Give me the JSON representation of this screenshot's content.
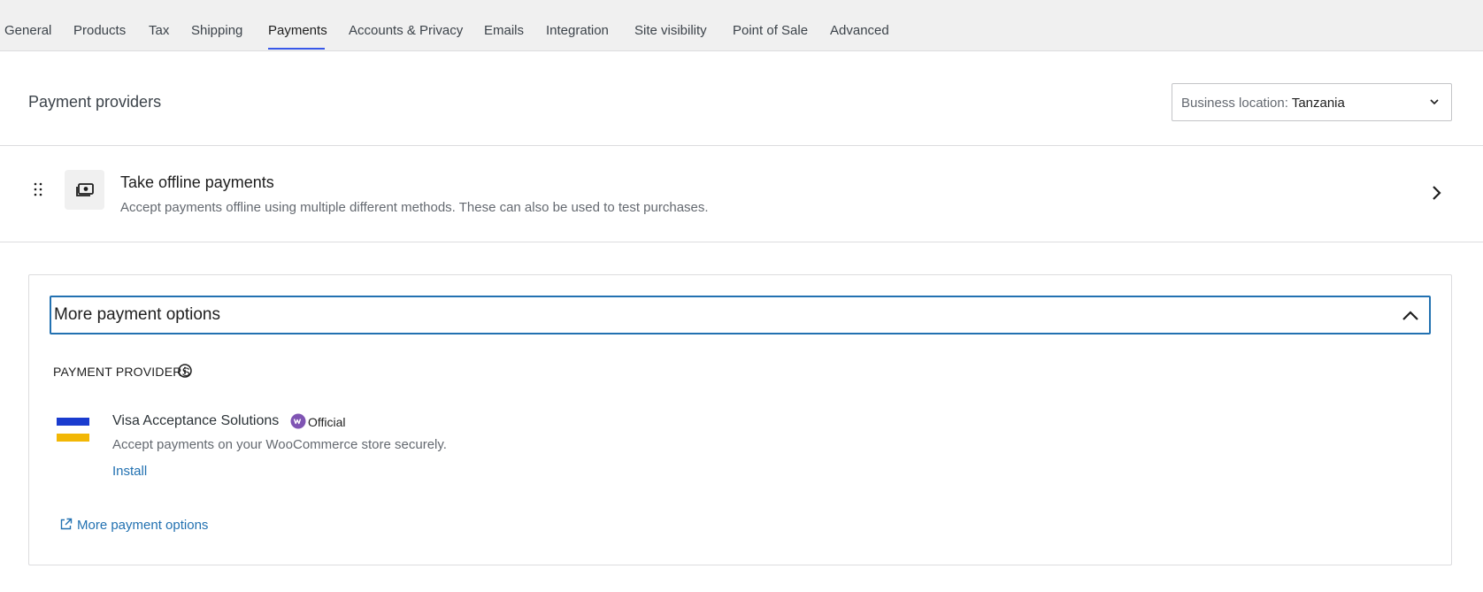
{
  "tabs": [
    {
      "label": "General"
    },
    {
      "label": "Products"
    },
    {
      "label": "Tax"
    },
    {
      "label": "Shipping"
    },
    {
      "label": "Payments"
    },
    {
      "label": "Accounts & Privacy"
    },
    {
      "label": "Emails"
    },
    {
      "label": "Integration"
    },
    {
      "label": "Site visibility"
    },
    {
      "label": "Point of Sale"
    },
    {
      "label": "Advanced"
    }
  ],
  "active_tab": "Payments",
  "header": {
    "title": "Payment providers",
    "location_label": "Business location: ",
    "location_value": "Tanzania"
  },
  "offline": {
    "title": "Take offline payments",
    "description": "Accept payments offline using multiple different methods. These can also be used to test purchases."
  },
  "more_options": {
    "header_title": "More payment options",
    "section_heading": "PAYMENT PROVIDERS",
    "provider": {
      "name": "Visa Acceptance Solutions",
      "badge": "Official",
      "description": "Accept payments on your WooCommerce store securely.",
      "action": "Install"
    },
    "footer_link": "More payment options"
  },
  "icons": {
    "drag": "drag-handle-icon",
    "offline": "cash-icon",
    "chevron_right": "chevron-right-icon",
    "chevron_up": "chevron-up-icon",
    "chevron_down": "chevron-down-icon",
    "info": "info-icon",
    "external": "external-link-icon",
    "badge": "woo-icon"
  },
  "colors": {
    "accent": "#3858e9",
    "link": "#2271b1",
    "badge": "#7f54b3",
    "visa_blue": "#1a3ccf",
    "visa_yellow": "#f2b705"
  }
}
